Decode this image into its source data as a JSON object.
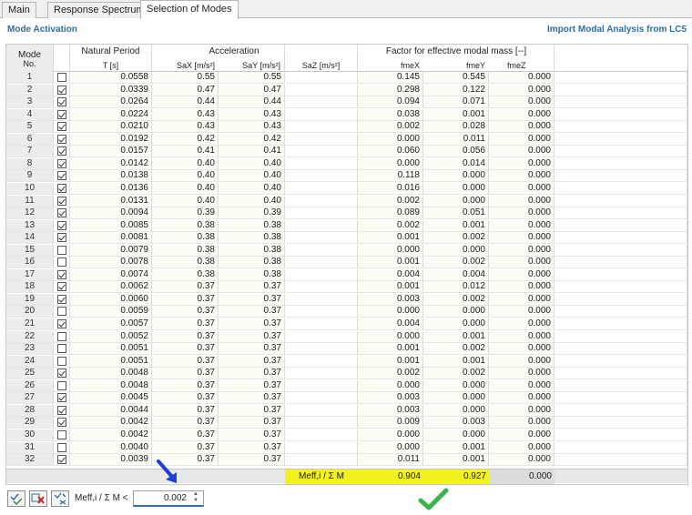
{
  "tabs": [
    {
      "label": "Main"
    },
    {
      "label": "Response Spectrum"
    },
    {
      "label": "Selection of Modes"
    }
  ],
  "section": {
    "title": "Mode Activation",
    "import_link": "Import Modal Analysis from LC5"
  },
  "headers": {
    "mode_top": "Mode",
    "mode_bottom": "No.",
    "natural_period": "Natural Period",
    "period_unit": "T [s]",
    "acceleration": "Acceleration",
    "sax": "SaX [m/s²]",
    "say": "SaY [m/s²]",
    "saz": "SaZ [m/s²]",
    "factor": "Factor for effective modal mass [--]",
    "fmex": "fmeX",
    "fmey": "fmeY",
    "fmez": "fmeZ"
  },
  "rows": [
    {
      "no": "1",
      "checked": false,
      "T": "0.0558",
      "sax": "0.55",
      "say": "0.55",
      "fx": "0.145",
      "fy": "0.545",
      "fz": "0.000"
    },
    {
      "no": "2",
      "checked": true,
      "T": "0.0339",
      "sax": "0.47",
      "say": "0.47",
      "fx": "0.298",
      "fy": "0.122",
      "fz": "0.000"
    },
    {
      "no": "3",
      "checked": true,
      "T": "0.0264",
      "sax": "0.44",
      "say": "0.44",
      "fx": "0.094",
      "fy": "0.071",
      "fz": "0.000"
    },
    {
      "no": "4",
      "checked": true,
      "T": "0.0224",
      "sax": "0.43",
      "say": "0.43",
      "fx": "0.038",
      "fy": "0.001",
      "fz": "0.000"
    },
    {
      "no": "5",
      "checked": true,
      "T": "0.0210",
      "sax": "0.43",
      "say": "0.43",
      "fx": "0.002",
      "fy": "0.028",
      "fz": "0.000"
    },
    {
      "no": "6",
      "checked": true,
      "T": "0.0192",
      "sax": "0.42",
      "say": "0.42",
      "fx": "0.000",
      "fy": "0.011",
      "fz": "0.000"
    },
    {
      "no": "7",
      "checked": true,
      "T": "0.0157",
      "sax": "0.41",
      "say": "0.41",
      "fx": "0.060",
      "fy": "0.056",
      "fz": "0.000"
    },
    {
      "no": "8",
      "checked": true,
      "T": "0.0142",
      "sax": "0.40",
      "say": "0.40",
      "fx": "0.000",
      "fy": "0.014",
      "fz": "0.000"
    },
    {
      "no": "9",
      "checked": true,
      "T": "0.0138",
      "sax": "0.40",
      "say": "0.40",
      "fx": "0.118",
      "fy": "0.000",
      "fz": "0.000"
    },
    {
      "no": "10",
      "checked": true,
      "T": "0.0136",
      "sax": "0.40",
      "say": "0.40",
      "fx": "0.016",
      "fy": "0.000",
      "fz": "0.000"
    },
    {
      "no": "11",
      "checked": true,
      "T": "0.0131",
      "sax": "0.40",
      "say": "0.40",
      "fx": "0.002",
      "fy": "0.000",
      "fz": "0.000"
    },
    {
      "no": "12",
      "checked": true,
      "T": "0.0094",
      "sax": "0.39",
      "say": "0.39",
      "fx": "0.089",
      "fy": "0.051",
      "fz": "0.000"
    },
    {
      "no": "13",
      "checked": true,
      "T": "0.0085",
      "sax": "0.38",
      "say": "0.38",
      "fx": "0.002",
      "fy": "0.001",
      "fz": "0.000"
    },
    {
      "no": "14",
      "checked": true,
      "T": "0.0081",
      "sax": "0.38",
      "say": "0.38",
      "fx": "0.001",
      "fy": "0.002",
      "fz": "0.000"
    },
    {
      "no": "15",
      "checked": false,
      "T": "0.0079",
      "sax": "0.38",
      "say": "0.38",
      "fx": "0.000",
      "fy": "0.000",
      "fz": "0.000"
    },
    {
      "no": "16",
      "checked": false,
      "T": "0.0078",
      "sax": "0.38",
      "say": "0.38",
      "fx": "0.001",
      "fy": "0.002",
      "fz": "0.000"
    },
    {
      "no": "17",
      "checked": true,
      "T": "0.0074",
      "sax": "0.38",
      "say": "0.38",
      "fx": "0.004",
      "fy": "0.004",
      "fz": "0.000"
    },
    {
      "no": "18",
      "checked": true,
      "T": "0.0062",
      "sax": "0.37",
      "say": "0.37",
      "fx": "0.001",
      "fy": "0.012",
      "fz": "0.000"
    },
    {
      "no": "19",
      "checked": true,
      "T": "0.0060",
      "sax": "0.37",
      "say": "0.37",
      "fx": "0.003",
      "fy": "0.002",
      "fz": "0.000"
    },
    {
      "no": "20",
      "checked": false,
      "T": "0.0059",
      "sax": "0.37",
      "say": "0.37",
      "fx": "0.000",
      "fy": "0.000",
      "fz": "0.000"
    },
    {
      "no": "21",
      "checked": true,
      "T": "0.0057",
      "sax": "0.37",
      "say": "0.37",
      "fx": "0.004",
      "fy": "0.000",
      "fz": "0.000"
    },
    {
      "no": "22",
      "checked": false,
      "T": "0.0052",
      "sax": "0.37",
      "say": "0.37",
      "fx": "0.000",
      "fy": "0.001",
      "fz": "0.000"
    },
    {
      "no": "23",
      "checked": false,
      "T": "0.0051",
      "sax": "0.37",
      "say": "0.37",
      "fx": "0.001",
      "fy": "0.002",
      "fz": "0.000"
    },
    {
      "no": "24",
      "checked": false,
      "T": "0.0051",
      "sax": "0.37",
      "say": "0.37",
      "fx": "0.001",
      "fy": "0.001",
      "fz": "0.000"
    },
    {
      "no": "25",
      "checked": true,
      "T": "0.0048",
      "sax": "0.37",
      "say": "0.37",
      "fx": "0.002",
      "fy": "0.002",
      "fz": "0.000"
    },
    {
      "no": "26",
      "checked": false,
      "T": "0.0048",
      "sax": "0.37",
      "say": "0.37",
      "fx": "0.000",
      "fy": "0.000",
      "fz": "0.000"
    },
    {
      "no": "27",
      "checked": true,
      "T": "0.0045",
      "sax": "0.37",
      "say": "0.37",
      "fx": "0.003",
      "fy": "0.000",
      "fz": "0.000"
    },
    {
      "no": "28",
      "checked": true,
      "T": "0.0044",
      "sax": "0.37",
      "say": "0.37",
      "fx": "0.003",
      "fy": "0.000",
      "fz": "0.000"
    },
    {
      "no": "29",
      "checked": true,
      "T": "0.0042",
      "sax": "0.37",
      "say": "0.37",
      "fx": "0.009",
      "fy": "0.003",
      "fz": "0.000"
    },
    {
      "no": "30",
      "checked": false,
      "T": "0.0042",
      "sax": "0.37",
      "say": "0.37",
      "fx": "0.000",
      "fy": "0.000",
      "fz": "0.000"
    },
    {
      "no": "31",
      "checked": false,
      "T": "0.0040",
      "sax": "0.37",
      "say": "0.37",
      "fx": "0.000",
      "fy": "0.001",
      "fz": "0.000"
    },
    {
      "no": "32",
      "checked": true,
      "T": "0.0039",
      "sax": "0.37",
      "say": "0.37",
      "fx": "0.011",
      "fy": "0.001",
      "fz": "0.000"
    }
  ],
  "sum": {
    "label": "Meff,i / Σ M",
    "fx": "0.904",
    "fy": "0.927",
    "fz": "0.000"
  },
  "toolbar": {
    "select_all_icon": "check-all-icon",
    "deselect_icon": "uncheck-all-icon",
    "invert_icon": "invert-selection-icon",
    "threshold_label": "Meff,i / Σ M <",
    "threshold_value": "0.002"
  },
  "annotations": {
    "arrow_icon": "blue-arrow-icon",
    "check_icon": "green-check-icon"
  },
  "colors": {
    "accent": "#2e6f9e",
    "highlight": "#f2f21e",
    "check_green": "#39b54a",
    "arrow_blue": "#1f3fd6"
  }
}
